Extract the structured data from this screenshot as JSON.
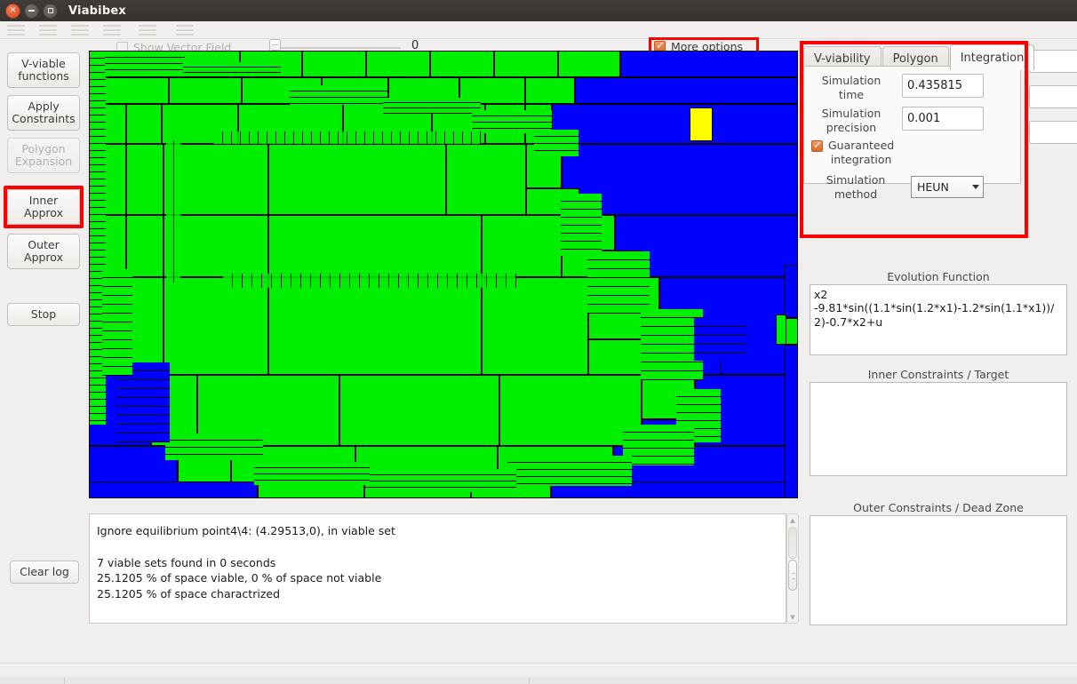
{
  "window": {
    "title": "Viabibex",
    "buttons": [
      {
        "name": "close",
        "glyph": "×"
      },
      {
        "name": "minimize",
        "glyph": "–"
      },
      {
        "name": "maximize",
        "glyph": "□"
      }
    ]
  },
  "menubar": {
    "items": [
      "menu-1",
      "menu-2",
      "menu-3",
      "menu-4",
      "menu-5",
      "menu-6"
    ]
  },
  "sidebar": {
    "buttons": [
      {
        "label": "V-viable\nfunctions",
        "label_lines": [
          "V-viable",
          "functions"
        ],
        "enabled": true,
        "highlighted": false
      },
      {
        "label": "Apply\nConstraints",
        "label_lines": [
          "Apply",
          "Constraints"
        ],
        "enabled": true,
        "highlighted": false
      },
      {
        "label": "Polygon\nExpansion",
        "label_lines": [
          "Polygon",
          "Expansion"
        ],
        "enabled": false,
        "highlighted": false
      },
      {
        "label": "Inner\nApprox",
        "label_lines": [
          "Inner",
          "Approx"
        ],
        "enabled": true,
        "highlighted": true
      },
      {
        "label": "Outer\nApprox",
        "label_lines": [
          "Outer",
          "Approx"
        ],
        "enabled": true,
        "highlighted": false
      },
      {
        "label": "Stop",
        "label_lines": [
          "Stop"
        ],
        "enabled": true,
        "highlighted": false
      }
    ],
    "clear_log_label": "Clear log"
  },
  "toolbar": {
    "show_vector_field_label": "Show Vector Field",
    "show_vector_field_checked": false,
    "slider_value": "0",
    "slider_position_pct": 0,
    "more_options_label": "More options",
    "more_options_checked": true,
    "more_options_highlighted": true
  },
  "tabs": {
    "items": [
      {
        "label": "V-viability",
        "active": false
      },
      {
        "label": "Polygon",
        "active": false
      },
      {
        "label": "Integration",
        "active": true
      }
    ],
    "highlighted": true
  },
  "integration": {
    "simulation_time_label": "Simulation time",
    "simulation_time_label_lines": [
      "Simulation",
      "time"
    ],
    "simulation_time_value": "0.435815",
    "simulation_precision_label": "Simulation precision",
    "simulation_precision_label_lines": [
      "Simulation",
      "precision"
    ],
    "simulation_precision_value": "0.001",
    "guaranteed_integration_label": "Guaranteed integration",
    "guaranteed_integration_label_lines": [
      "Guaranteed",
      "integration"
    ],
    "guaranteed_integration_checked": true,
    "simulation_method_label": "Simulation method",
    "simulation_method_label_lines": [
      "Simulation",
      "method"
    ],
    "simulation_method_value": "HEUN",
    "simulation_method_options": [
      "HEUN"
    ]
  },
  "background_spinners": [
    {
      "value": ""
    },
    {
      "value": ""
    },
    {
      "value": ""
    }
  ],
  "panels": {
    "evolution_function": {
      "title": "Evolution Function",
      "value": "x2\n-9.81*sin((1.1*sin(1.2*x1)-1.2*sin(1.1*x1))/2)-0.7*x2+u"
    },
    "inner_constraints": {
      "title": "Inner Constraints / Target",
      "value": ""
    },
    "outer_constraints": {
      "title": "Outer Constraints / Dead Zone",
      "value": ""
    }
  },
  "log": {
    "text": "Ignore equilibrium point4\\4: (4.29513,0), in viable set\n\n7 viable sets found in 0 seconds\n25.1205 % of space viable, 0 % of space not viable\n25.1205 % of space charactrized",
    "lines": [
      "Ignore equilibrium point4\\4: (4.29513,0), in viable set",
      "",
      "7 viable sets found in 0 seconds",
      "25.1205 % of space viable, 0 % of space not viable",
      "25.1205 % of space charactrized"
    ]
  },
  "plot": {
    "description": "Quadtree box-subdivision viability kernel plot",
    "colors": {
      "viable": "#00ee00",
      "non_viable": "#0000ff",
      "current_box": "#ffff00",
      "border": "#000000"
    },
    "legend": {
      "viable": "viable set (green)",
      "unknown": "not characterized (blue)",
      "current": "current box (yellow)"
    }
  },
  "theme": {
    "highlight_color": "#ff0000",
    "accent_color": "#dd6a2a",
    "window_bg": "#f1efed",
    "titlebar_bg": "#3a3633"
  }
}
